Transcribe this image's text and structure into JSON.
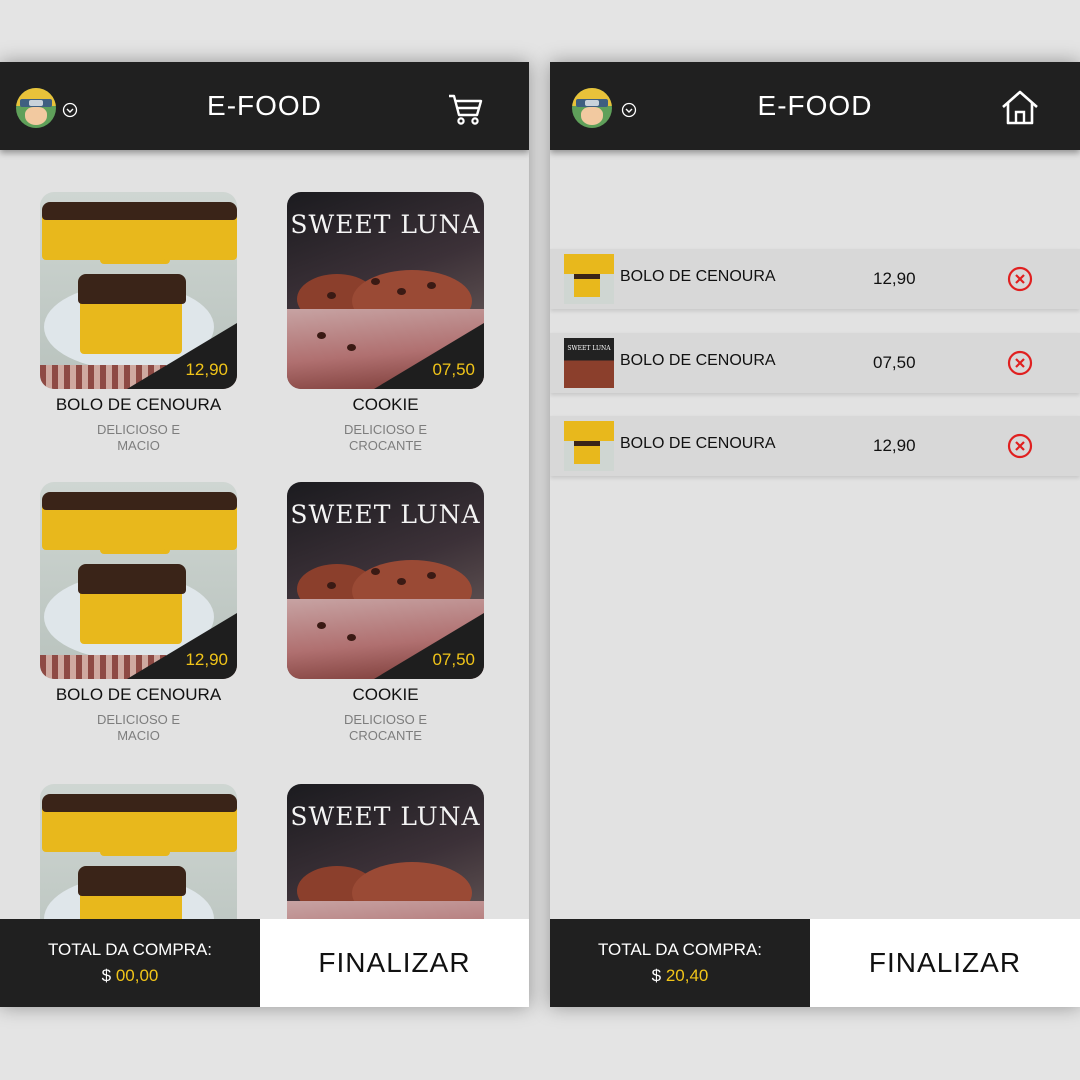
{
  "colors": {
    "header": "#202020",
    "accent": "#f0c419",
    "remove": "#e02020"
  },
  "menu_screen": {
    "header": {
      "title": "E-FOOD",
      "avatar_icon": "user-avatar",
      "dropdown_icon": "chevron-down-icon",
      "action_icon": "cart-icon"
    },
    "products": [
      {
        "name": "BOLO DE CENOURA",
        "description": "DELICIOSO E MACIO",
        "price": "12,90",
        "image": "cake"
      },
      {
        "name": "COOKIE",
        "description": "DELICIOSO E CROCANTE",
        "price": "07,50",
        "image": "cookie",
        "brand": "SWEET LUNA"
      },
      {
        "name": "BOLO DE CENOURA",
        "description": "DELICIOSO E MACIO",
        "price": "12,90",
        "image": "cake"
      },
      {
        "name": "COOKIE",
        "description": "DELICIOSO E CROCANTE",
        "price": "07,50",
        "image": "cookie",
        "brand": "SWEET LUNA"
      },
      {
        "image": "cake"
      },
      {
        "image": "cookie",
        "brand": "SWEET LUNA"
      }
    ],
    "footer": {
      "total_label": "TOTAL DA COMPRA:",
      "currency": "$",
      "total_value": "00,00",
      "finalize_label": "FINALIZAR"
    }
  },
  "cart_screen": {
    "header": {
      "title": "E-FOOD",
      "avatar_icon": "user-avatar",
      "dropdown_icon": "chevron-down-icon",
      "action_icon": "home-icon"
    },
    "items": [
      {
        "name": "BOLO DE CENOURA",
        "price": "12,90",
        "thumb": "cake",
        "remove_icon": "remove-circle-icon"
      },
      {
        "name": "BOLO DE CENOURA",
        "price": "07,50",
        "thumb": "cookie",
        "thumb_brand": "SWEET LUNA",
        "remove_icon": "remove-circle-icon"
      },
      {
        "name": "BOLO DE CENOURA",
        "price": "12,90",
        "thumb": "cake",
        "remove_icon": "remove-circle-icon"
      }
    ],
    "footer": {
      "total_label": "TOTAL DA COMPRA:",
      "currency": "$",
      "total_value": "20,40",
      "finalize_label": "FINALIZAR"
    }
  }
}
